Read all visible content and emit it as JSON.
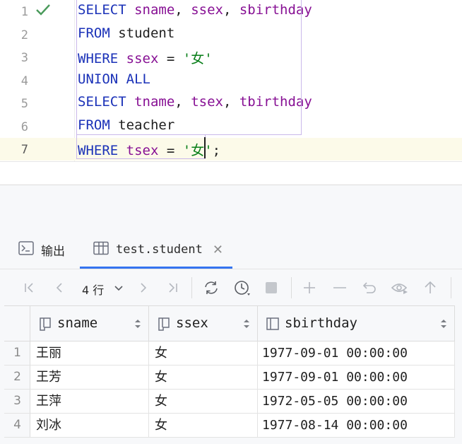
{
  "editor": {
    "lines": [
      {
        "number": "1",
        "tokens": [
          {
            "t": "SELECT",
            "c": "kw"
          },
          {
            "t": " ",
            "c": ""
          },
          {
            "t": "sname",
            "c": "id"
          },
          {
            "t": ", ",
            "c": ""
          },
          {
            "t": "ssex",
            "c": "id"
          },
          {
            "t": ", ",
            "c": ""
          },
          {
            "t": "sbirthday",
            "c": "id"
          }
        ]
      },
      {
        "number": "2",
        "tokens": [
          {
            "t": "FROM",
            "c": "kw"
          },
          {
            "t": " student",
            "c": ""
          }
        ]
      },
      {
        "number": "3",
        "tokens": [
          {
            "t": "WHERE",
            "c": "kw"
          },
          {
            "t": " ",
            "c": ""
          },
          {
            "t": "ssex",
            "c": "id"
          },
          {
            "t": " = ",
            "c": ""
          },
          {
            "t": "'女'",
            "c": "str"
          }
        ]
      },
      {
        "number": "4",
        "tokens": [
          {
            "t": "UNION ALL",
            "c": "kw"
          }
        ]
      },
      {
        "number": "5",
        "tokens": [
          {
            "t": "SELECT",
            "c": "kw"
          },
          {
            "t": " ",
            "c": ""
          },
          {
            "t": "tname",
            "c": "id"
          },
          {
            "t": ", ",
            "c": ""
          },
          {
            "t": "tsex",
            "c": "id"
          },
          {
            "t": ", ",
            "c": ""
          },
          {
            "t": "tbirthday",
            "c": "id"
          }
        ]
      },
      {
        "number": "6",
        "tokens": [
          {
            "t": "FROM",
            "c": "kw"
          },
          {
            "t": " teacher",
            "c": ""
          }
        ]
      },
      {
        "number": "7",
        "tokens": [
          {
            "t": "WHERE",
            "c": "kw"
          },
          {
            "t": " ",
            "c": ""
          },
          {
            "t": "tsex",
            "c": "id"
          },
          {
            "t": " = ",
            "c": ""
          },
          {
            "t": "'女'",
            "c": "str"
          },
          {
            "t": ";",
            "c": ""
          }
        ]
      }
    ],
    "current_line": "7",
    "executed_icon": "checkmark-icon"
  },
  "tabs": {
    "output_label": "输出",
    "table_label": "test.student",
    "close_icon": "close-icon"
  },
  "toolbar": {
    "rows_label": "4 行"
  },
  "grid": {
    "columns": [
      "sname",
      "ssex",
      "sbirthday"
    ],
    "rows": [
      {
        "num": "1",
        "sname": "王丽",
        "ssex": "女",
        "sbirthday": "1977-09-01 00:00:00"
      },
      {
        "num": "2",
        "sname": "王芳",
        "ssex": "女",
        "sbirthday": "1977-09-01 00:00:00"
      },
      {
        "num": "3",
        "sname": "王萍",
        "ssex": "女",
        "sbirthday": "1972-05-05 00:00:00"
      },
      {
        "num": "4",
        "sname": "刘冰",
        "ssex": "女",
        "sbirthday": "1977-08-14 00:00:00"
      }
    ]
  },
  "colors": {
    "keyword": "#1b32b8",
    "identifier": "#871094",
    "string": "#067d17",
    "accent": "#3574f0",
    "success": "#4a9a5b"
  }
}
